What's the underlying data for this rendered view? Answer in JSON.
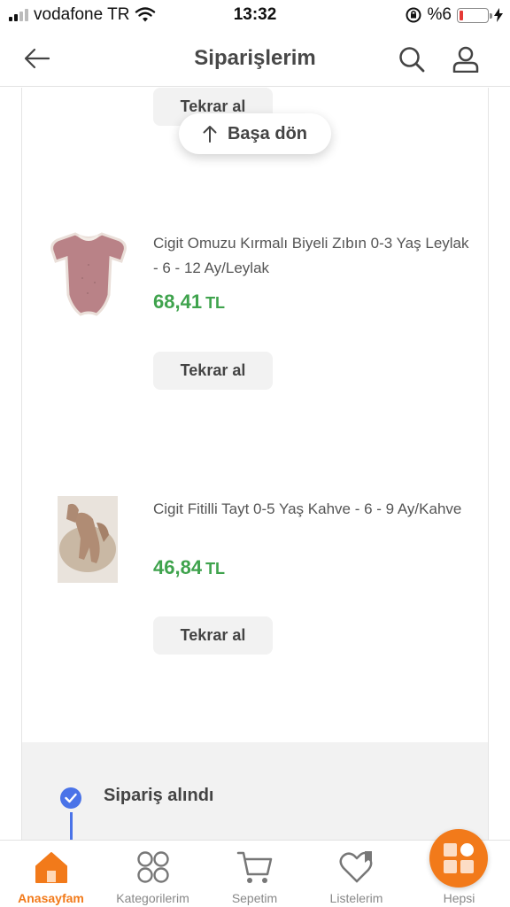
{
  "status_bar": {
    "carrier": "vodafone TR",
    "time": "13:32",
    "battery_text": "%6",
    "battery_level": 0.06
  },
  "header": {
    "title": "Siparişlerim",
    "icons": [
      "back-arrow-icon",
      "search-icon",
      "user-icon"
    ]
  },
  "back_to_top": {
    "label": "Başa dön"
  },
  "order": {
    "items": [
      {
        "reorder_label": "Tekrar al"
      },
      {
        "name": "Cigit Omuzu Kırmalı Biyeli Zıbın 0-3 Yaş Leylak - 6 - 12 Ay/Leylak",
        "price": "68,41",
        "currency": "TL",
        "reorder_label": "Tekrar al"
      },
      {
        "name": "Cigit Fitilli Tayt 0-5 Yaş Kahve - 6 - 9 Ay/Kahve",
        "price": "46,84",
        "currency": "TL",
        "reorder_label": "Tekrar al"
      }
    ],
    "status": {
      "label": "Sipariş alındı"
    }
  },
  "tab_bar": {
    "tabs": [
      {
        "label": "Anasayfam",
        "icon": "home-icon",
        "active": true
      },
      {
        "label": "Kategorilerim",
        "icon": "categories-icon",
        "active": false
      },
      {
        "label": "Sepetim",
        "icon": "cart-icon",
        "active": false
      },
      {
        "label": "Listelerim",
        "icon": "heart-list-icon",
        "active": false
      },
      {
        "label": "Hepsi",
        "icon": "all-grid-icon",
        "active": false
      }
    ]
  },
  "colors": {
    "accent": "#f27a1a",
    "price": "#3fa34d",
    "status_blue": "#4a73e8"
  }
}
